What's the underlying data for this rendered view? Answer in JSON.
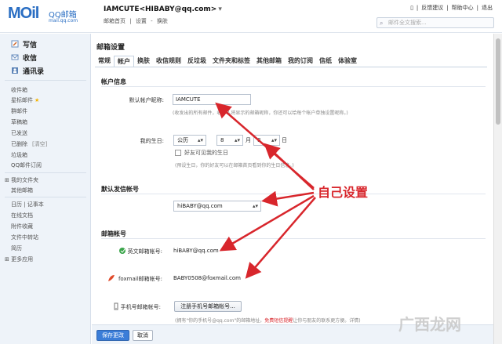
{
  "header": {
    "logo_main": "MOil",
    "logo_cn": "QQ邮箱",
    "logo_sub": "mail.qq.com",
    "account": "IAMCUTE<HIBABY@qq.com>",
    "account_arrow": "▾",
    "account_links": [
      "邮箱首页",
      "|",
      "设置",
      "-",
      "换肤"
    ],
    "top_links": [
      "反馈建议",
      "帮助中心",
      "退出"
    ],
    "search_placeholder": "邮件全文搜索..."
  },
  "sidebar": {
    "actions": [
      {
        "label": "写信",
        "icon": "pencil-icon"
      },
      {
        "label": "收信",
        "icon": "inbox-icon"
      },
      {
        "label": "通讯录",
        "icon": "contacts-icon"
      }
    ],
    "folders": [
      "收件箱",
      "星标邮件",
      "群邮件",
      "草稿箱",
      "已发送",
      "已删除",
      "垃圾箱",
      "QQ邮件订阅"
    ],
    "clear_label": "[清空]",
    "my_folders": "我的文件夹",
    "other_mailbox": "其他邮箱",
    "apps": [
      "日历 | 记事本",
      "在线文档",
      "附件收藏",
      "文件中转站",
      "简历"
    ],
    "more_apps": "更多应用"
  },
  "content": {
    "title": "邮箱设置",
    "tabs": [
      "常规",
      "帐户",
      "换肤",
      "收信规则",
      "反垃圾",
      "文件夹和标签",
      "其他邮箱",
      "我的订阅",
      "信纸",
      "体验室"
    ],
    "account_info": {
      "section": "帐户信息",
      "nickname_label": "默认帐户昵称:",
      "nickname_value": "IAMCUTE",
      "nickname_hint": "(收发出的所有邮件，收件人将显示的邮箱昵称，你还可以给每个帐户单独设置昵称。)",
      "birthday_label": "我的生日:",
      "calendar": "公历",
      "month": "8",
      "month_unit": "月",
      "day": "8",
      "day_unit": "日",
      "friends_check": "好友可见我的生日",
      "birthday_hint": "(预设生日，你的好友可以在邮箱首页看到你的生日信息。)"
    },
    "default_sender": {
      "section": "默认发信帐号",
      "value": "hiBABY@qq.com"
    },
    "accounts": {
      "section": "邮箱帐号",
      "english_label": "英文邮箱帐号:",
      "english_value": "hiBABY@qq.com",
      "foxmail_label": "foxmail邮箱帐号:",
      "foxmail_value": "BABY0508@foxmail.com",
      "phone_label": "手机号邮箱帐号:",
      "phone_button": "注册手机号邮箱帐号...",
      "phone_hint_a": "(拥有\"你的手机号@qq.com\"的邮箱地址，",
      "phone_hint_b": "免费短信提醒",
      "phone_hint_c": "让你与朋友的联系更方便。详情)"
    },
    "annotation": "自己设置"
  },
  "bottom": {
    "save": "保存更改",
    "cancel": "取消"
  },
  "watermark": "广西龙网"
}
